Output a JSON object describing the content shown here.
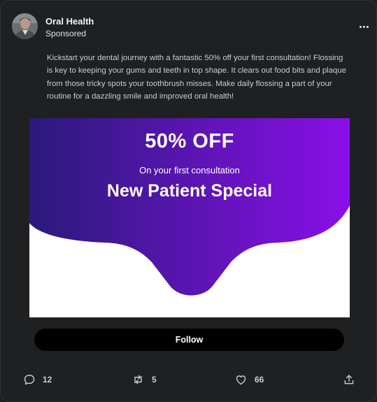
{
  "post": {
    "author_name": "Oral Health",
    "sponsored_label": "Sponsored",
    "body_text": "Kickstart your dental journey with a fantastic 50% off your first consultation! Flossing is key to keeping your gums and teeth in top shape. It clears out food bits and plaque from those tricky spots your toothbrush misses. Make daily flossing a part of your routine for a dazzling smile and improved oral health!"
  },
  "promo": {
    "headline": "50% OFF",
    "subline": "On your first consultation",
    "title": "New Patient Special",
    "gradient_start": "#2a1a7a",
    "gradient_end": "#8a0fe8"
  },
  "follow_button": {
    "label": "Follow"
  },
  "actions": {
    "replies": "12",
    "reposts": "5",
    "likes": "66"
  },
  "icons": [
    "more-icon",
    "reply-icon",
    "repost-icon",
    "like-icon",
    "share-icon"
  ]
}
